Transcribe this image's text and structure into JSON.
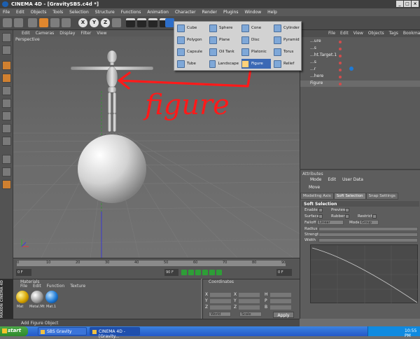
{
  "window": {
    "title": "CINEMA 4D - [GravitySBS.c4d *]",
    "controls": [
      "_",
      "□",
      "×"
    ]
  },
  "menu": [
    "File",
    "Edit",
    "Objects",
    "Tools",
    "Selection",
    "Structure",
    "Functions",
    "Animation",
    "Character",
    "Render",
    "Plugins",
    "Window",
    "Help"
  ],
  "viewport": {
    "menu": [
      "Edit",
      "Cameras",
      "Display",
      "Filter",
      "View"
    ],
    "label": "Perspective"
  },
  "annotation": {
    "text": "figure",
    "color": "#ff1a1a"
  },
  "primitives_menu": {
    "columns": [
      [
        "Cube",
        "Polygon",
        "Capsule",
        "Tube"
      ],
      [
        "Sphere",
        "Plane",
        "Oil Tank",
        "Landscape"
      ],
      [
        "Cone",
        "Disc",
        "Platonic",
        "Figure"
      ],
      [
        "Cylinder",
        "Pyramid",
        "Torus",
        "Relief"
      ]
    ],
    "highlighted": "Figure"
  },
  "object_manager": {
    "menu": [
      "File",
      "Edit",
      "View",
      "Objects",
      "Tags",
      "Bookmarks"
    ],
    "rows": [
      "...ure",
      "...s",
      "...ht.Target.1",
      "...s",
      "...r",
      "...here",
      "Figure"
    ],
    "selected": "Figure"
  },
  "attributes": {
    "header": "Attributes",
    "menu": [
      "Mode",
      "Edit",
      "User Data"
    ],
    "tool": "Move",
    "tabs": [
      "Modelling Axis",
      "Soft Selection",
      "Snap Settings"
    ],
    "active_tab": "Soft Selection",
    "section": "Soft Selection",
    "fields": {
      "enable": "Enable",
      "preview": "Preview",
      "surface": "Surface",
      "rubber": "Rubber",
      "restrict": "Restrict",
      "falloff": "Falloff",
      "falloff_value": "Linear",
      "mode": "Mode",
      "mode_value": "Group",
      "radius": "Radius",
      "strength": "Strength",
      "width": "Width"
    }
  },
  "timeline": {
    "ticks": [
      "0",
      "10",
      "20",
      "30",
      "40",
      "50",
      "60",
      "70",
      "80",
      "90"
    ],
    "start_frame": "0 F",
    "end_frame": "90 F",
    "current": "0 F"
  },
  "material_manager": {
    "header": "Materials",
    "menu": [
      "File",
      "Edit",
      "Function",
      "Texture"
    ],
    "materials": [
      "Mat",
      "Metal.Mt",
      "Mat.1"
    ]
  },
  "coordinates": {
    "header": "Coordinates",
    "rows": [
      [
        "X",
        "X",
        "H"
      ],
      [
        "Y",
        "Y",
        "P"
      ],
      [
        "Z",
        "Z",
        "B"
      ]
    ],
    "dropdowns": [
      "World",
      "Scale"
    ],
    "apply": "Apply"
  },
  "status": "Add Figure Object",
  "maxon": "MAXON CINEMA 4D",
  "taskbar": {
    "start": "start",
    "tasks": [
      "SBS Gravity",
      "CINEMA 4D - [Gravity..."
    ],
    "active": "CINEMA 4D - [Gravity...",
    "time": "10:55 PM"
  }
}
